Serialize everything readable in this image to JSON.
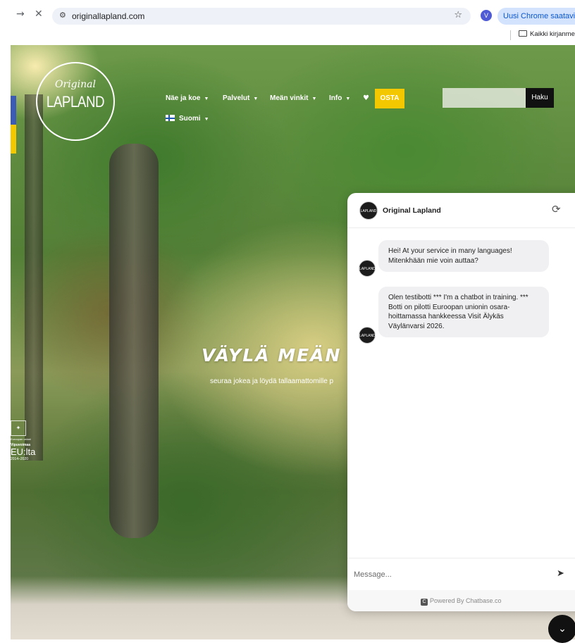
{
  "browser": {
    "url": "originallapland.com",
    "profile_initial": "V",
    "update_button": "Uusi Chrome saatavilla",
    "bookmarks_label": "Kaikki kirjanmerkit"
  },
  "site": {
    "logo_script": "Original",
    "logo_main": "LAPLAND",
    "menu": [
      {
        "label": "Näe ja koe"
      },
      {
        "label": "Palvelut"
      },
      {
        "label": "Meän vinkit"
      },
      {
        "label": "Info"
      }
    ],
    "buy_label": "OSTA",
    "language": "Suomi",
    "search_button": "Haku",
    "search_placeholder": "",
    "hero_title": "VÄYLÄ MEÄN L",
    "hero_subtitle": "seuraa jokea ja löydä tallaamattomille p",
    "eu": {
      "small_text": "Euroopan unioni",
      "vipuvoimaa": "Vipuvoimaa",
      "big": "EU:lta",
      "years": "2014–2020"
    }
  },
  "chat": {
    "title": "Original Lapland",
    "messages": [
      {
        "text": "Hei! At your service in many languages! Mitenkhään mie voin auttaa?"
      },
      {
        "text": "Olen testibotti *** I'm a chatbot in training. *** Botti on pilotti Euroopan unionin osara-hoittamassa hankkeessa Visit Älykäs Väylänvarsi 2026."
      }
    ],
    "input_placeholder": "Message...",
    "powered_by": "Powered By Chatbase.co"
  },
  "colors": {
    "accent_yellow": "#f3c800",
    "eu_blue": "#3b5bb5",
    "chrome_update": "#d3e3fd"
  },
  "icons": [
    "forward-icon",
    "close-icon",
    "site-info-icon",
    "star-icon",
    "folder-icon",
    "heart-icon",
    "refresh-icon",
    "send-icon",
    "chevron-down-icon"
  ]
}
